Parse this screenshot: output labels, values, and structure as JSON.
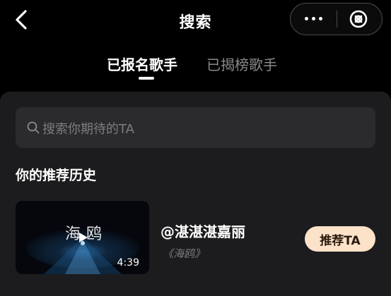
{
  "header": {
    "title": "搜索",
    "back_icon": "chevron-left-icon",
    "more_icon": "more-dots-icon",
    "close_icon": "close-circle-icon"
  },
  "tabs": [
    {
      "label": "已报名歌手",
      "active": true
    },
    {
      "label": "已揭榜歌手",
      "active": false
    }
  ],
  "search": {
    "placeholder": "搜索你期待的TA",
    "icon": "search-icon"
  },
  "history": {
    "title": "你的推荐历史",
    "items": [
      {
        "video_title": "海鸥",
        "duration": "4:39",
        "singer": "@湛湛湛嘉丽",
        "song": "《海鸥》",
        "action_label": "推荐TA"
      }
    ]
  },
  "colors": {
    "background": "#000000",
    "panel": "#1c1c1e",
    "search_field": "#2b2b2d",
    "muted_text": "#7d7d80",
    "action_button": "#fbe2c8",
    "action_text": "#2a1a0e"
  }
}
